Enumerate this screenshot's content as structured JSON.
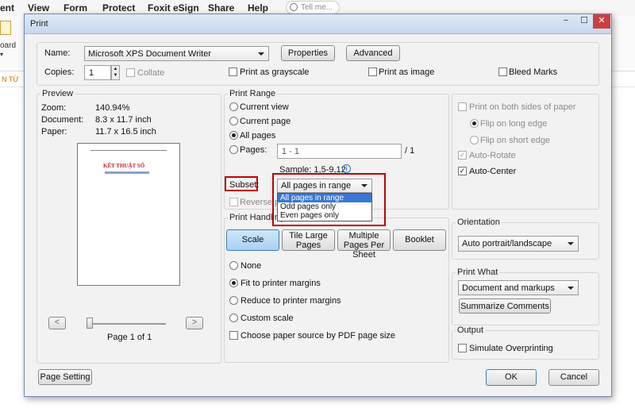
{
  "background_app": {
    "menu": [
      "ent",
      "View",
      "Form",
      "Protect",
      "Foxit eSign",
      "Share",
      "Help"
    ],
    "tell_me_placeholder": "Tell me...",
    "ribbon_clip_label": "oard",
    "subbar_text": "N TỪ"
  },
  "dialog": {
    "title": "Print",
    "minimize_glyph": "−",
    "maximize_glyph": "☐",
    "close_glyph": "✕",
    "printer": {
      "name_label": "Name:",
      "name_value": "Microsoft XPS Document Writer",
      "properties_button": "Properties",
      "advanced_button": "Advanced",
      "copies_label": "Copies:",
      "copies_value": "1",
      "collate_label": "Collate",
      "grayscale_label": "Print as grayscale",
      "image_label": "Print as image",
      "bleed_label": "Bleed Marks"
    },
    "preview": {
      "group_label": "Preview",
      "zoom_label": "Zoom:",
      "zoom_value": "140.94%",
      "document_label": "Document:",
      "document_value": "8.3 x 11.7 inch",
      "paper_label": "Paper:",
      "paper_value": "11.7 x 16.5 inch",
      "page_heading": "KẾT THUẬT SỐ",
      "prev_glyph": "<",
      "next_glyph": ">",
      "page_indicator": "Page 1 of 1",
      "page_setting_button": "Page Setting"
    },
    "print_range": {
      "group_label": "Print Range",
      "current_view": "Current view",
      "current_page": "Current page",
      "all_pages": "All pages",
      "pages_label": "Pages:",
      "pages_value": "1 - 1",
      "pages_total": "/ 1",
      "sample": "Sample: 1,5-9,12",
      "info_glyph": "i",
      "subset_label": "Subset:",
      "subset_value": "All pages in range",
      "subset_options": [
        "All pages in range",
        "Odd pages only",
        "Even pages only"
      ],
      "reverse_label": "Reverse pa"
    },
    "print_handling": {
      "group_label": "Print Handling",
      "tabs": [
        "Scale",
        "Tile Large Pages",
        "Multiple Pages Per Sheet",
        "Booklet"
      ],
      "none": "None",
      "fit": "Fit to printer margins",
      "reduce": "Reduce to printer margins",
      "custom": "Custom scale",
      "choose_paper": "Choose paper source by PDF page size"
    },
    "duplex": {
      "both_sides": "Print on both sides of paper",
      "long_edge": "Flip on long edge",
      "short_edge": "Flip on short edge",
      "auto_rotate": "Auto-Rotate",
      "auto_center": "Auto-Center"
    },
    "orientation": {
      "group_label": "Orientation",
      "value": "Auto portrait/landscape"
    },
    "print_what": {
      "group_label": "Print What",
      "value": "Document and markups",
      "summarize_button": "Summarize Comments"
    },
    "output": {
      "group_label": "Output",
      "simulate_label": "Simulate Overprinting"
    },
    "ok_button": "OK",
    "cancel_button": "Cancel"
  },
  "colors": {
    "highlight_red": "#c00000",
    "selection_blue": "#3a78d4",
    "title_gradient": "#c7d8ee"
  }
}
